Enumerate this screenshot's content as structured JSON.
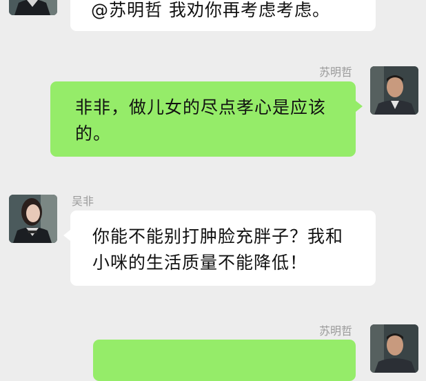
{
  "messages": [
    {
      "side": "left",
      "sender": "",
      "text": "@苏明哲  我劝你再考虑考虑。"
    },
    {
      "side": "right",
      "sender": "苏明哲",
      "text": "非非，做儿女的尽点孝心是应该的。"
    },
    {
      "side": "left",
      "sender": "吴非",
      "text": "你能不能别打肿脸充胖子？我和小咪的生活质量不能降低！"
    },
    {
      "side": "right",
      "sender": "苏明哲",
      "text": ""
    }
  ],
  "colors": {
    "background": "#ededed",
    "incoming_bubble": "#ffffff",
    "outgoing_bubble": "#95ec69",
    "sender_name": "#9a9a9a"
  },
  "icons": {
    "incoming_avatar": "woman-avatar",
    "outgoing_avatar": "man-avatar"
  }
}
